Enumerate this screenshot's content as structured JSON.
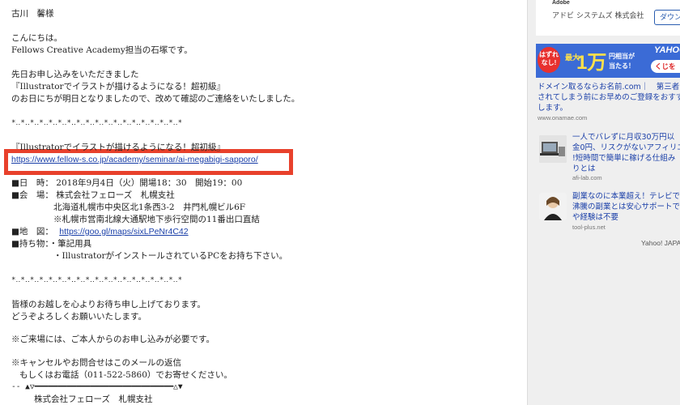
{
  "email": {
    "recipient": "古川　馨様",
    "greeting": "こんにちは。",
    "sender_intro": "Fellows Creative Academy担当の石塚です。",
    "p1_l1": "先日お申し込みをいただきました",
    "p1_l2": "『Illustratorでイラストが描けるようになる！超初級』",
    "p1_l3": "のお日にちが明日となりましたので、改めて確認のご連絡をいたしました。",
    "separator": "*‥*‥*‥*‥*‥*‥*‥*‥*‥*‥*‥*‥*‥*‥*‥*‥*‥*‥*",
    "seminar_title": "『Illustratorでイラストが描けるようになる！超初級』",
    "seminar_url": "https://www.fellow-s.co.jp/academy/seminar/ai-megabigi-sapporo/",
    "date_line": "■日　時：  2018年9月4日（火）開場18：30　開始19：00",
    "venue_line": "■会　場：  株式会社フェローズ　札幌支社",
    "venue_addr1": "北海道札幌市中央区北1条西3-2　井門札幌ビル6F",
    "venue_addr2": "※札幌市営南北線大通駅地下歩行空間の11番出口直結",
    "map_label": "■地　図：",
    "map_url": "https://goo.gl/maps/sixLPeNr4C42",
    "items_line": "■持ち物：・筆記用具",
    "items_l2": "・IllustratorがインストールされているPCをお持ち下さい。",
    "closing1": "皆様のお越しを心よりお待ち申し上げております。",
    "closing2": "どうぞよろしくお願いいたします。",
    "note1": "※ご来場には、ご本人からのお申し込みが必要です。",
    "note2": "※キャンセルやお問合せはこのメールの返信",
    "note3": "もしくはお電話（011-522-5860）でお寄せください。",
    "sig_rule": "-- ▲▽━━━━━━━━━━━━━━━━━━━━━━━━━━━━━━△▼",
    "sig_company": "株式会社フェローズ　札幌支社"
  },
  "sidebar": {
    "adobe_brand": "Adobe",
    "adobe_company": "アドビ システムズ 株式会社",
    "download_label": "ダウンロ",
    "banner": {
      "yahoo": "YAHOO",
      "tag": "はずれなし!",
      "man": "最大",
      "big": "1万",
      "txt1": "円相当が",
      "txt2": "当たる！",
      "kuji": "くじを"
    },
    "ads": [
      {
        "title_l1": "ドメイン取るならお名前.com｜　第三者",
        "title_l2": "されてしまう前にお早めのご登録をおすす",
        "title_l3": "します。",
        "url": "www.onamae.com"
      },
      {
        "title_l1": "一人でバレずに月収30万円以",
        "title_l2": "金0円、リスクがないアフィリエイ",
        "title_l3": "!短時間で簡単に稼げる仕組み",
        "title_l4": "りとは",
        "url": "afi-lab.com"
      },
      {
        "title_l1": "副業なのに本業超え！テレビで",
        "title_l2": "沸騰の副業とは安心サポートで",
        "title_l3": "や経験は不要",
        "url": "tool-plus.net"
      }
    ],
    "footer": "Yahoo! JAPA"
  },
  "colors": {
    "highlight": "#e8412c",
    "link": "#1a3fa8",
    "banner": "#3b6bd6"
  }
}
